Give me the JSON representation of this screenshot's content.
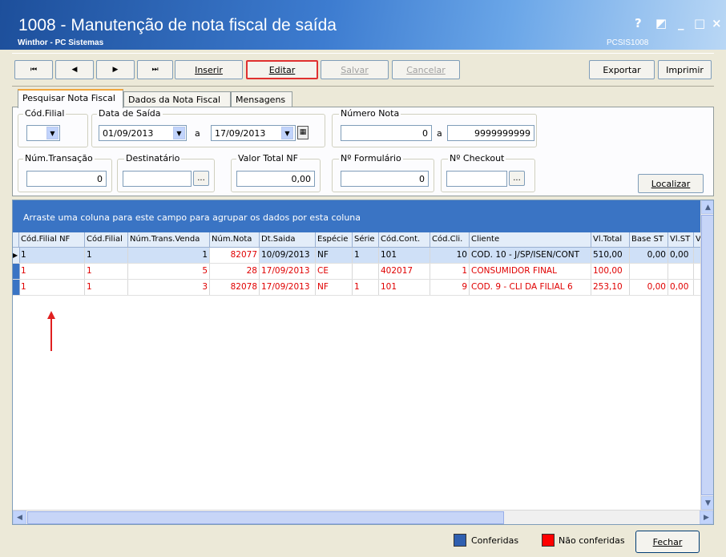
{
  "window": {
    "title": "1008 - Manutenção de nota fiscal de saída",
    "subtitle": "Winthor - PC Sistemas",
    "code": "PCSIS1008",
    "controls": {
      "help": "?",
      "restore": "◩",
      "minimize": "_",
      "maximize": "□",
      "close": "×"
    }
  },
  "toolbar": {
    "first": "⏮",
    "prev": "◀",
    "next": "▶",
    "last": "⏭",
    "inserir": "Inserir",
    "editar": "Editar",
    "salvar": "Salvar",
    "cancelar": "Cancelar",
    "exportar": "Exportar",
    "imprimir": "Imprimir",
    "highlight_color": "#e03030"
  },
  "tabs": [
    "Pesquisar Nota Fiscal",
    "Dados da Nota Fiscal",
    "Mensagens"
  ],
  "filters": {
    "cod_filial": {
      "label": "Cód.Filial",
      "value": ""
    },
    "data_saida": {
      "label": "Data de Saída",
      "from": "01/09/2013",
      "sep": "a",
      "to": "17/09/2013"
    },
    "numero_nota": {
      "label": "Número Nota",
      "from": "0",
      "sep": "a",
      "to": "9999999999"
    },
    "num_transacao": {
      "label": "Núm.Transação",
      "value": "0"
    },
    "destinatario": {
      "label": "Destinatário",
      "value": "",
      "btn": "..."
    },
    "valor_total": {
      "label": "Valor Total NF",
      "value": "0,00"
    },
    "num_formulario": {
      "label": "Nº Formulário",
      "value": "0"
    },
    "num_checkout": {
      "label": "Nº Checkout",
      "value": "",
      "btn": "..."
    },
    "localizar": "Localizar"
  },
  "grid": {
    "group_hint": "Arraste uma coluna para este campo para agrupar os dados por esta coluna",
    "columns": [
      "Cód.Filial NF",
      "Cód.Filial",
      "Núm.Trans.Venda",
      "Núm.Nota",
      "Dt.Saida",
      "Espécie",
      "Série",
      "Cód.Cont.",
      "Cód.Cli.",
      "Cliente",
      "Vl.Total",
      "Base ST",
      "Vl.ST",
      "Vl.D"
    ],
    "rows": [
      {
        "cells": [
          "1",
          "1",
          "1",
          "82077",
          "10/09/2013",
          "NF",
          "1",
          "101",
          "10",
          "COD. 10 - J/SP/ISEN/CONT",
          "510,00",
          "0,00",
          "0,00",
          ""
        ],
        "status": "conferida"
      },
      {
        "cells": [
          "1",
          "1",
          "5",
          "28",
          "17/09/2013",
          "CE",
          "",
          "402017",
          "1",
          "CONSUMIDOR FINAL",
          "100,00",
          "",
          "",
          ""
        ],
        "status": "nao_conferida"
      },
      {
        "cells": [
          "1",
          "1",
          "3",
          "82078",
          "17/09/2013",
          "NF",
          "1",
          "101",
          "9",
          "COD. 9 - CLI DA FILIAL 6",
          "253,10",
          "0,00",
          "0,00",
          ""
        ],
        "status": "nao_conferida"
      }
    ]
  },
  "legend": {
    "conferidas": "Conferidas",
    "nao_conferidas": "Não conferidas",
    "conferidas_color": "#2f5fb0",
    "nao_conferidas_color": "#ff0000"
  },
  "fechar": "Fechar"
}
